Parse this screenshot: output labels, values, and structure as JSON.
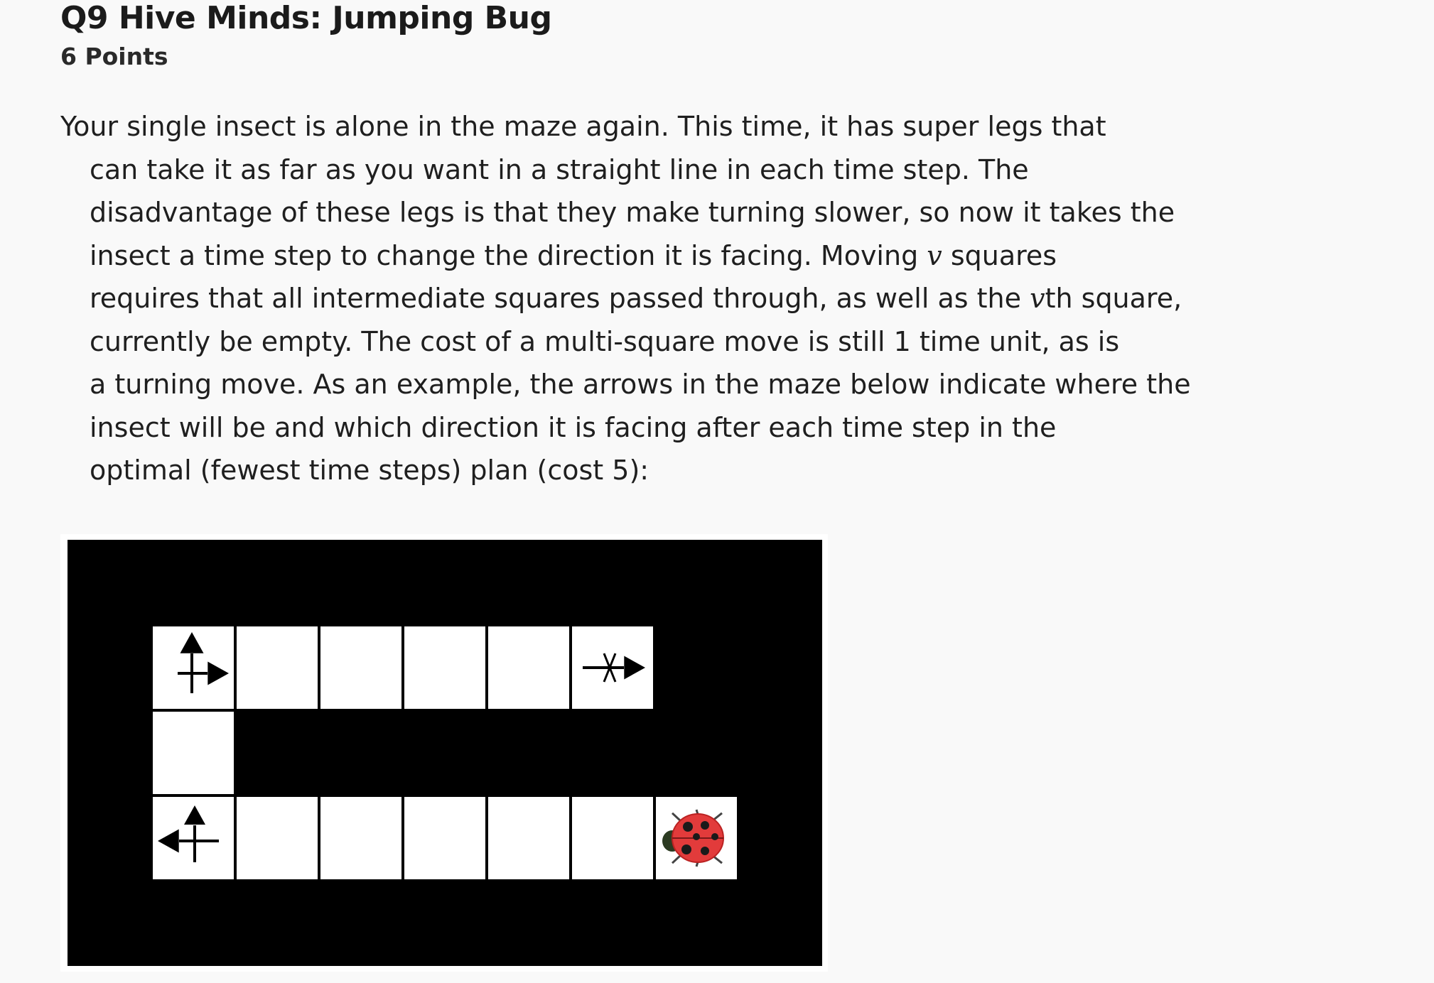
{
  "question": {
    "title": "Q9 Hive Minds: Jumping Bug",
    "points": "6 Points"
  },
  "prompt": {
    "line1": "Your single insect is alone in the maze again. This time, it has super legs that",
    "line2": "can take it as far as you want in a straight line in each time step. The",
    "line3": "disadvantage of these legs is that they make turning slower, so now it takes the",
    "line4_a": "insect a time step to change the direction it is facing. Moving ",
    "line4_var": "v",
    "line4_b": " squares",
    "line5_a": "requires that all intermediate squares passed through, as well as the ",
    "line5_var": "v",
    "line5_b": "th square,",
    "line6": "currently be empty. The cost of a multi-square move is still 1 time unit, as is",
    "line7": "a turning move. As an example, the arrows in the maze below indicate where the",
    "line8": "insect will be and which direction it is facing after each time step in the",
    "line9": "optimal (fewest time steps) plan (cost 5):"
  },
  "maze": {
    "cols": 9,
    "rows": 5,
    "open_cells": [
      [
        1,
        1
      ],
      [
        2,
        1
      ],
      [
        3,
        1
      ],
      [
        4,
        1
      ],
      [
        5,
        1
      ],
      [
        6,
        1
      ],
      [
        1,
        2
      ],
      [
        1,
        3
      ],
      [
        2,
        3
      ],
      [
        3,
        3
      ],
      [
        4,
        3
      ],
      [
        5,
        3
      ],
      [
        6,
        3
      ],
      [
        7,
        3
      ]
    ],
    "markers": [
      {
        "cell": [
          7,
          3
        ],
        "icon": "ladybug-icon"
      },
      {
        "cell": [
          1,
          3
        ],
        "icon": "arrow-left-up-icon"
      },
      {
        "cell": [
          1,
          1
        ],
        "icon": "arrow-up-right-icon"
      },
      {
        "cell": [
          6,
          1
        ],
        "icon": "arrow-right-icon"
      }
    ],
    "colors": {
      "wall": "#000000",
      "open": "#ffffff",
      "grid": "#cccccc",
      "bug_body": "#e23b3b",
      "bug_spot": "#1a1a1a"
    }
  }
}
